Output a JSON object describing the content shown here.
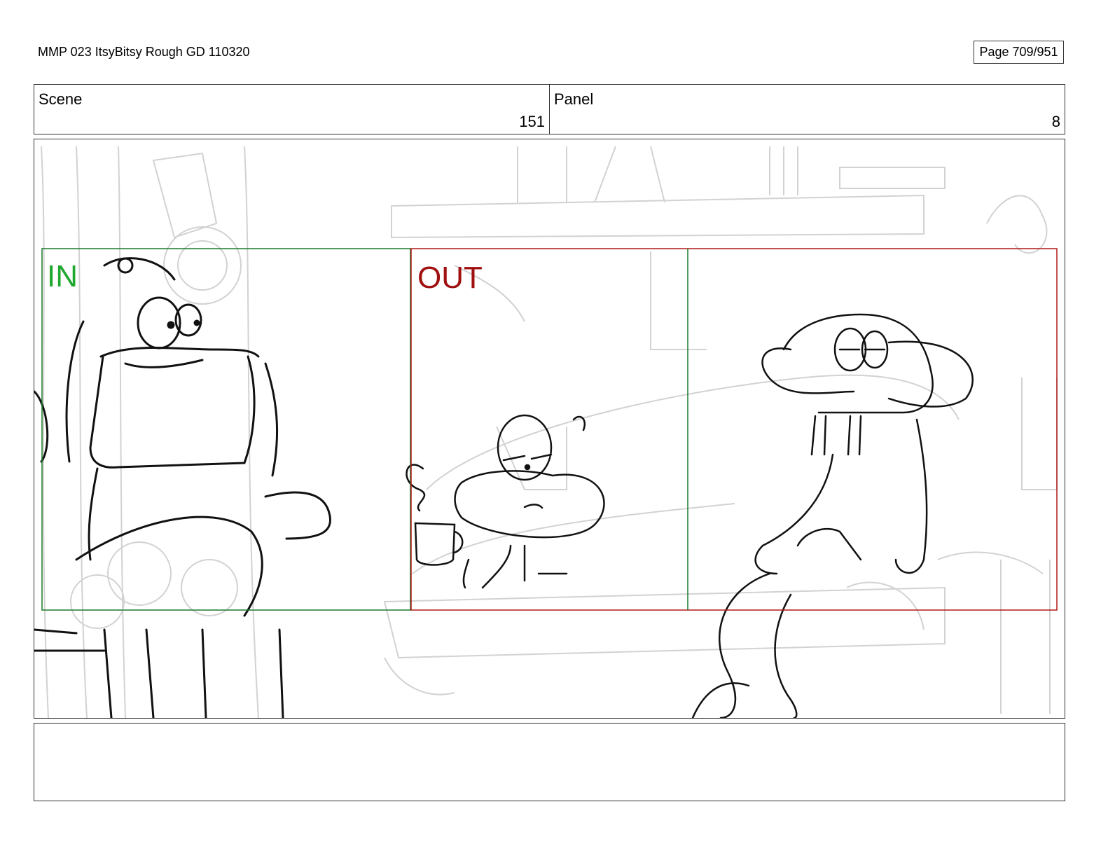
{
  "header": {
    "document_title": "MMP 023 ItsyBitsy Rough GD 110320",
    "page_label": "Page 709/951"
  },
  "info": {
    "scene_label": "Scene",
    "scene_number": "151",
    "panel_label": "Panel",
    "panel_number": "8"
  },
  "frame": {
    "in_label": "IN",
    "out_label": "OUT",
    "in_color": "#1a7a2a",
    "out_color": "#b01818",
    "in_text_color": "#1fa82e",
    "out_text_color": "#a01010"
  },
  "notes": {
    "text": ""
  }
}
